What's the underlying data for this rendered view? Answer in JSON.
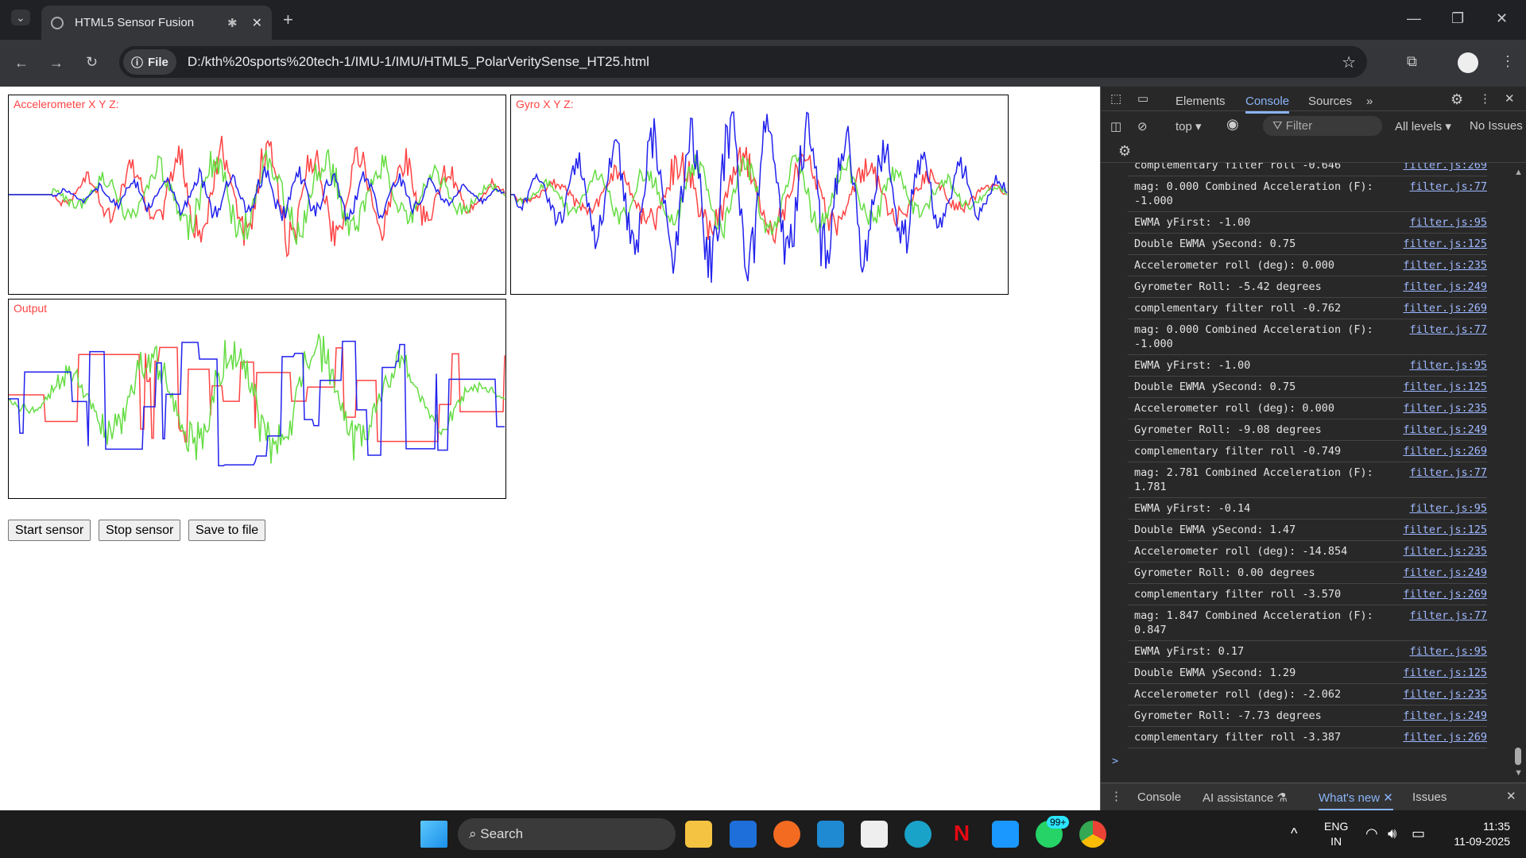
{
  "browser": {
    "tab_title": "HTML5 Sensor Fusion",
    "address_chip": "File",
    "url": "D:/kth%20sports%20tech-1/IMU-1/IMU/HTML5_PolarVeritySense_HT25.html"
  },
  "page": {
    "accel_label": "Accelerometer X Y Z:",
    "gyro_label": "Gyro X Y Z:",
    "output_label": "Output",
    "buttons": {
      "start": "Start sensor",
      "stop": "Stop sensor",
      "save": "Save to file"
    },
    "series_colors": {
      "x": "#ff4444",
      "y": "#66dd44",
      "z": "#2222ee"
    }
  },
  "devtools": {
    "tabs": [
      "Elements",
      "Console",
      "Sources"
    ],
    "active_tab": "Console",
    "context": "top",
    "filter_placeholder": "Filter",
    "levels": "All levels",
    "issues": "No Issues",
    "truncated_top": "complementary filter roll -0.646",
    "truncated_src": "filter.js:269",
    "log": [
      {
        "msg": "mag: 0.000 Combined Acceleration (F): -1.000",
        "src": "filter.js:77"
      },
      {
        "msg": "EWMA yFirst:  -1.00",
        "src": "filter.js:95"
      },
      {
        "msg": "Double EWMA ySecond: 0.75",
        "src": "filter.js:125"
      },
      {
        "msg": "Accelerometer roll (deg): 0.000",
        "src": "filter.js:235"
      },
      {
        "msg": "Gyrometer Roll: -5.42 degrees",
        "src": "filter.js:249"
      },
      {
        "msg": "complementary filter roll -0.762",
        "src": "filter.js:269"
      },
      {
        "msg": "mag: 0.000 Combined Acceleration (F): -1.000",
        "src": "filter.js:77"
      },
      {
        "msg": "EWMA yFirst:  -1.00",
        "src": "filter.js:95"
      },
      {
        "msg": "Double EWMA ySecond: 0.75",
        "src": "filter.js:125"
      },
      {
        "msg": "Accelerometer roll (deg): 0.000",
        "src": "filter.js:235"
      },
      {
        "msg": "Gyrometer Roll: -9.08 degrees",
        "src": "filter.js:249"
      },
      {
        "msg": "complementary filter roll -0.749",
        "src": "filter.js:269"
      },
      {
        "msg": "mag: 2.781 Combined Acceleration (F): 1.781",
        "src": "filter.js:77"
      },
      {
        "msg": "EWMA yFirst:  -0.14",
        "src": "filter.js:95"
      },
      {
        "msg": "Double EWMA ySecond: 1.47",
        "src": "filter.js:125"
      },
      {
        "msg": "Accelerometer roll (deg): -14.854",
        "src": "filter.js:235"
      },
      {
        "msg": "Gyrometer Roll: 0.00 degrees",
        "src": "filter.js:249"
      },
      {
        "msg": "complementary filter roll -3.570",
        "src": "filter.js:269"
      },
      {
        "msg": "mag: 1.847 Combined Acceleration (F): 0.847",
        "src": "filter.js:77"
      },
      {
        "msg": "EWMA yFirst:  0.17",
        "src": "filter.js:95"
      },
      {
        "msg": "Double EWMA ySecond: 1.29",
        "src": "filter.js:125"
      },
      {
        "msg": "Accelerometer roll (deg): -2.062",
        "src": "filter.js:235"
      },
      {
        "msg": "Gyrometer Roll: -7.73 degrees",
        "src": "filter.js:249"
      },
      {
        "msg": "complementary filter roll -3.387",
        "src": "filter.js:269"
      }
    ],
    "prompt": ">",
    "drawer_tabs": [
      "Console",
      "AI assistance",
      "What's new",
      "Issues"
    ],
    "drawer_active": "What's new"
  },
  "taskbar": {
    "search": "Search",
    "badge": "99+",
    "lang1": "ENG",
    "lang2": "IN",
    "time": "11:35",
    "date": "11-09-2025"
  }
}
